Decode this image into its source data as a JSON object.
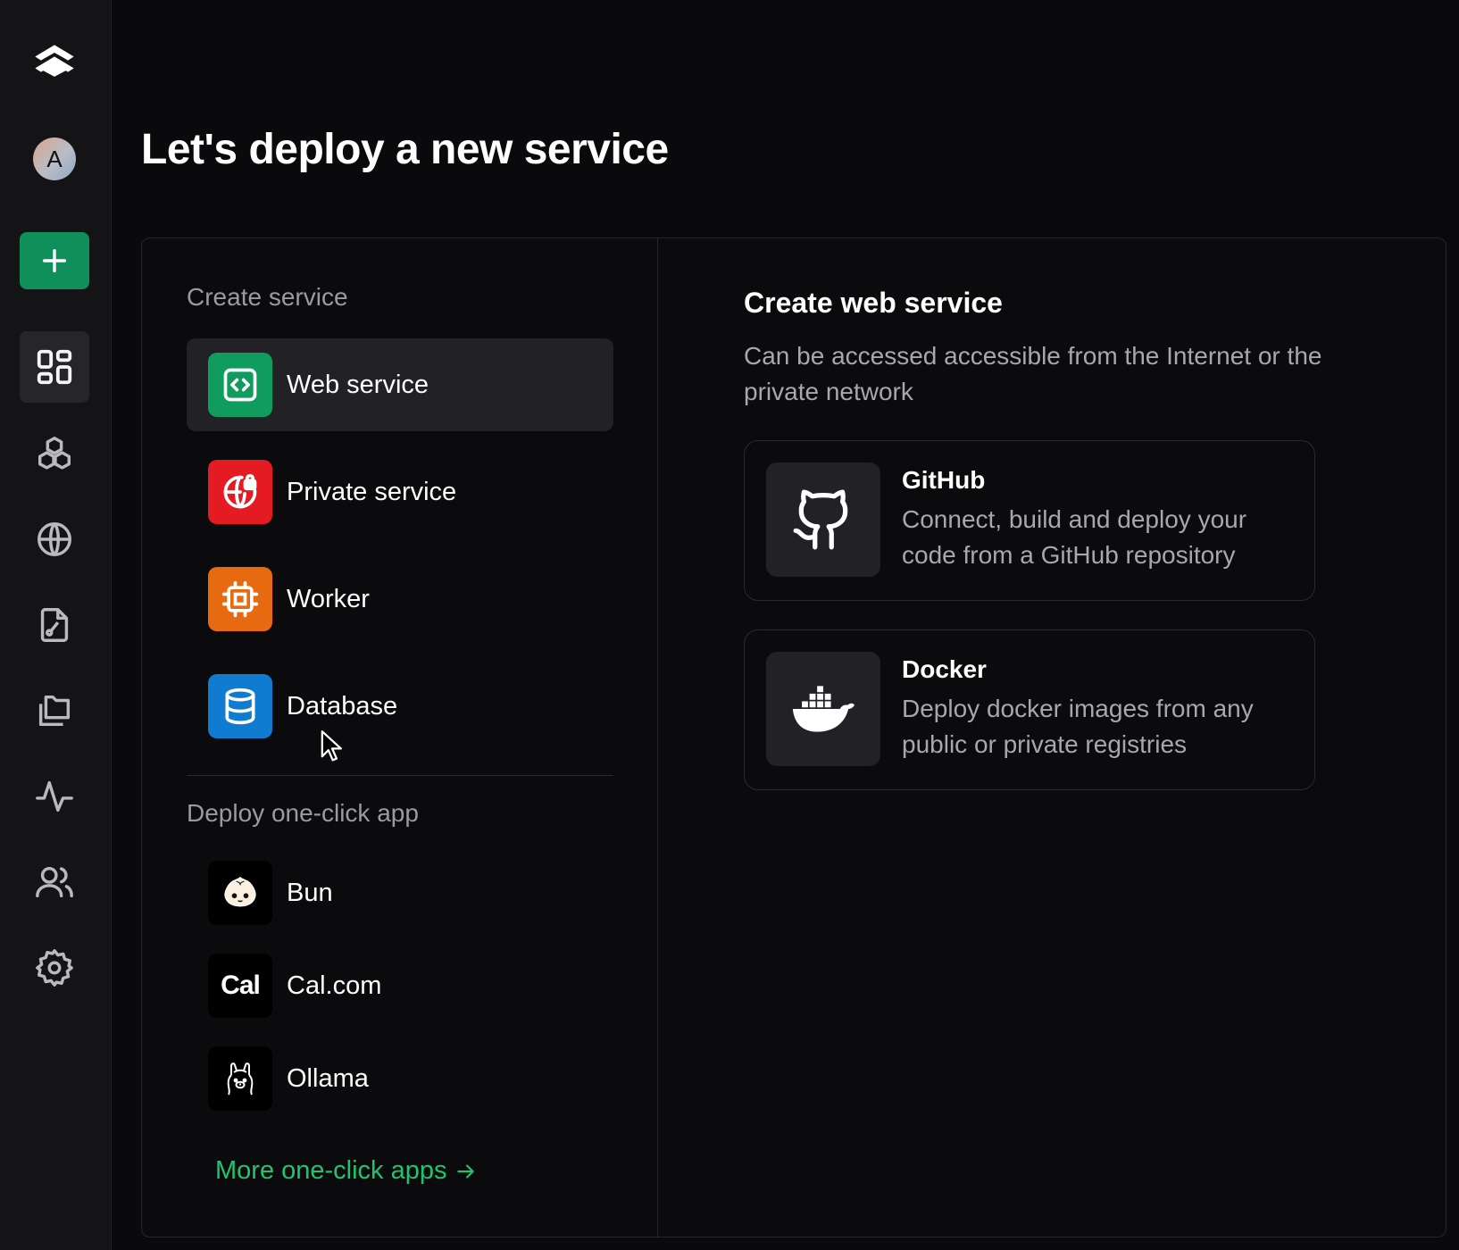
{
  "sidebar": {
    "avatar_initial": "A",
    "icons": [
      "logo-icon",
      "avatar",
      "plus-icon",
      "dashboard-icon",
      "boxes-icon",
      "globe-icon",
      "file-chart-icon",
      "folders-icon",
      "activity-icon",
      "users-icon",
      "gear-icon"
    ]
  },
  "page": {
    "title": "Let's deploy a new service"
  },
  "create_service": {
    "heading": "Create service",
    "items": [
      {
        "label": "Web service",
        "color": "#109b5f",
        "icon": "code-icon"
      },
      {
        "label": "Private service",
        "color": "#e51b23",
        "icon": "globe-lock-icon"
      },
      {
        "label": "Worker",
        "color": "#e86a10",
        "icon": "cpu-icon"
      },
      {
        "label": "Database",
        "color": "#0f7bd1",
        "icon": "database-icon"
      }
    ],
    "selected": "Web service"
  },
  "one_click": {
    "heading": "Deploy one-click app",
    "apps": [
      {
        "label": "Bun",
        "icon": "bun-icon"
      },
      {
        "label": "Cal.com",
        "icon": "cal-icon",
        "glyph": "Cal"
      },
      {
        "label": "Ollama",
        "icon": "ollama-icon"
      }
    ],
    "more_label": "More one-click apps"
  },
  "detail": {
    "title": "Create web service",
    "description": "Can be accessed accessible from the Internet or the private network",
    "sources": [
      {
        "name": "GitHub",
        "description": "Connect, build and deploy your code from a GitHub repository",
        "icon": "github-icon"
      },
      {
        "name": "Docker",
        "description": "Deploy docker images from any public or private registries",
        "icon": "docker-icon"
      }
    ]
  },
  "colors": {
    "accent_green": "#20c36f",
    "new_button": "#0f8f5a"
  }
}
